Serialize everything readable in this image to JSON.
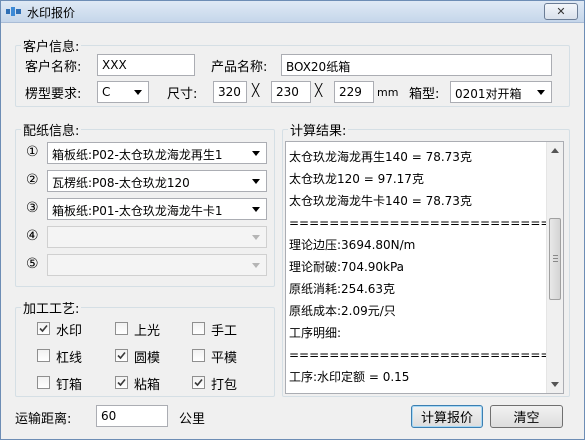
{
  "window": {
    "title": "水印报价",
    "close_glyph": "✕"
  },
  "customer": {
    "group_label": "客户信息:",
    "name_label": "客户名称:",
    "name_value": "XXX",
    "product_label": "产品名称:",
    "product_value": "BOX20纸箱",
    "corrugation_label": "楞型要求:",
    "corrugation_value": "C",
    "size_label": "尺寸:",
    "size_l": "320",
    "size_w": "230",
    "size_h": "229",
    "times_glyph": "╳",
    "unit": "mm",
    "box_type_label": "箱型:",
    "box_type_value": "0201对开箱"
  },
  "paper": {
    "group_label": "配纸信息:",
    "rows": [
      {
        "num": "①",
        "value": "箱板纸:P02-太仓玖龙海龙再生1",
        "enabled": true
      },
      {
        "num": "②",
        "value": "瓦楞纸:P08-太仓玖龙120",
        "enabled": true
      },
      {
        "num": "③",
        "value": "箱板纸:P01-太仓玖龙海龙牛卡1",
        "enabled": true
      },
      {
        "num": "④",
        "value": "",
        "enabled": false
      },
      {
        "num": "⑤",
        "value": "",
        "enabled": false
      }
    ]
  },
  "process": {
    "group_label": "加工工艺:",
    "items": [
      {
        "label": "水印",
        "checked": true
      },
      {
        "label": "上光",
        "checked": false
      },
      {
        "label": "手工",
        "checked": false
      },
      {
        "label": "杠线",
        "checked": false
      },
      {
        "label": "圆模",
        "checked": true
      },
      {
        "label": "平模",
        "checked": false
      },
      {
        "label": "钉箱",
        "checked": false
      },
      {
        "label": "粘箱",
        "checked": true
      },
      {
        "label": "打包",
        "checked": true
      }
    ]
  },
  "results": {
    "group_label": "计算结果:",
    "lines": [
      "太仓玖龙海龙再生140 = 78.73克",
      "太仓玖龙120 = 97.17克",
      "太仓玖龙海龙牛卡140 = 78.73克",
      "==============================",
      "理论边压:3694.80N/m",
      "理论耐破:704.90kPa",
      "原纸消耗:254.63克",
      "原纸成本:2.09元/只",
      "工序明细:",
      "==============================",
      "工序:水印定额 = 0.15"
    ]
  },
  "transport": {
    "label": "运输距离:",
    "value": "60",
    "unit": "公里"
  },
  "buttons": {
    "calculate": "计算报价",
    "clear": "清空"
  },
  "colors": {
    "title_gradient_top": "#dfe9f5",
    "accent": "#3c7fb1"
  }
}
